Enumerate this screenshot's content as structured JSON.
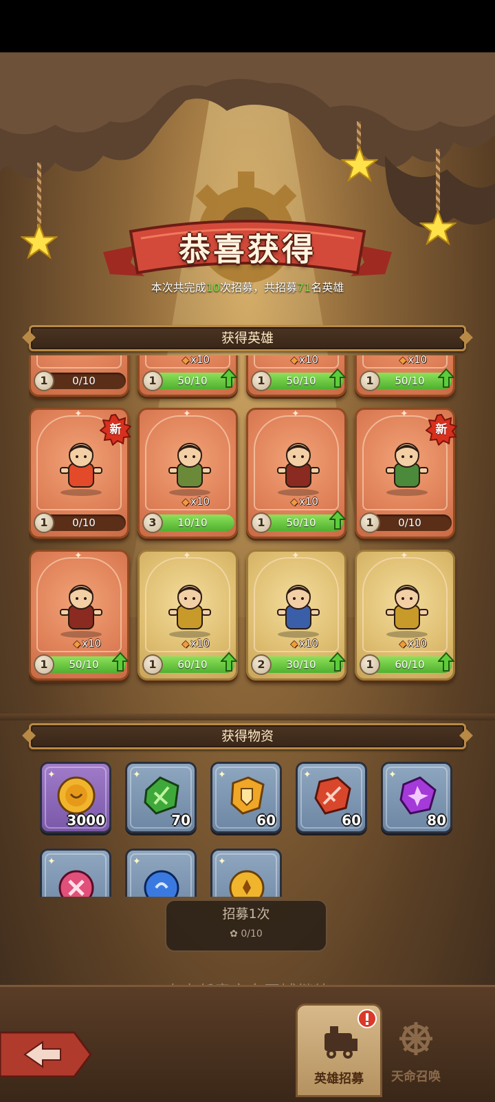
{
  "header": {
    "title": "恭喜获得",
    "summary_prefix": "本次共完成",
    "recruit_times": "10",
    "summary_middle": "次招募，共招募",
    "hero_total": "71",
    "summary_suffix": "名英雄"
  },
  "sections": {
    "heroes_title": "获得英雄",
    "items_title": "获得物资"
  },
  "heroes": [
    {
      "id": "h1",
      "rarity": "orange",
      "level": "1",
      "qty": "",
      "progress_text": "0/10",
      "progress": 0,
      "upgradable": false,
      "is_new": false
    },
    {
      "id": "h2",
      "rarity": "orange",
      "level": "1",
      "qty": "x10",
      "progress_text": "50/10",
      "progress": 1,
      "upgradable": true,
      "is_new": false
    },
    {
      "id": "h3",
      "rarity": "orange",
      "level": "1",
      "qty": "x10",
      "progress_text": "50/10",
      "progress": 1,
      "upgradable": true,
      "is_new": false
    },
    {
      "id": "h4",
      "rarity": "orange",
      "level": "1",
      "qty": "x10",
      "progress_text": "50/10",
      "progress": 1,
      "upgradable": true,
      "is_new": false
    },
    {
      "id": "h5",
      "rarity": "orange",
      "level": "1",
      "qty": "",
      "progress_text": "0/10",
      "progress": 0,
      "upgradable": false,
      "is_new": true
    },
    {
      "id": "h6",
      "rarity": "orange",
      "level": "3",
      "qty": "x10",
      "progress_text": "10/10",
      "progress": 1,
      "upgradable": false,
      "is_new": false
    },
    {
      "id": "h7",
      "rarity": "orange",
      "level": "1",
      "qty": "x10",
      "progress_text": "50/10",
      "progress": 1,
      "upgradable": true,
      "is_new": false
    },
    {
      "id": "h8",
      "rarity": "orange",
      "level": "1",
      "qty": "",
      "progress_text": "0/10",
      "progress": 0,
      "upgradable": false,
      "is_new": true
    },
    {
      "id": "h9",
      "rarity": "orange",
      "level": "1",
      "qty": "x10",
      "progress_text": "50/10",
      "progress": 1,
      "upgradable": true,
      "is_new": false
    },
    {
      "id": "h10",
      "rarity": "gold",
      "level": "1",
      "qty": "x10",
      "progress_text": "60/10",
      "progress": 1,
      "upgradable": true,
      "is_new": false
    },
    {
      "id": "h11",
      "rarity": "gold",
      "level": "2",
      "qty": "x10",
      "progress_text": "30/10",
      "progress": 1,
      "upgradable": true,
      "is_new": false
    },
    {
      "id": "h12",
      "rarity": "gold",
      "level": "1",
      "qty": "x10",
      "progress_text": "60/10",
      "progress": 1,
      "upgradable": true,
      "is_new": false
    }
  ],
  "new_badge_label": "新",
  "items": [
    {
      "icon": "coin-icon",
      "count": "3000",
      "frame": "purple"
    },
    {
      "icon": "bow-gem-icon",
      "count": "70",
      "frame": "blue"
    },
    {
      "icon": "shield-gem-icon",
      "count": "60",
      "frame": "blue"
    },
    {
      "icon": "sword-gem-icon",
      "count": "60",
      "frame": "blue"
    },
    {
      "icon": "shuriken-gem-icon",
      "count": "80",
      "frame": "blue"
    },
    {
      "icon": "cross-gem-icon",
      "count": "",
      "frame": "blue"
    },
    {
      "icon": "blue-gem-icon",
      "count": "",
      "frame": "blue"
    },
    {
      "icon": "gold-token-icon",
      "count": "",
      "frame": "blue"
    }
  ],
  "recruit_button": {
    "label": "招募1次",
    "cost": "0/10"
  },
  "continue_hint": "点击任意空白区域继续",
  "bottom_nav": {
    "tabs": [
      {
        "label": "英雄招募",
        "active": true,
        "icon": "train-icon"
      },
      {
        "label": "天命召唤",
        "active": false,
        "icon": "gear-wheel-icon"
      }
    ]
  },
  "colors": {
    "highlight_number": "#7ee24a",
    "progress_fill": "#4fb130",
    "card_orange": "#e0825a",
    "card_gold": "#dfbf72"
  }
}
